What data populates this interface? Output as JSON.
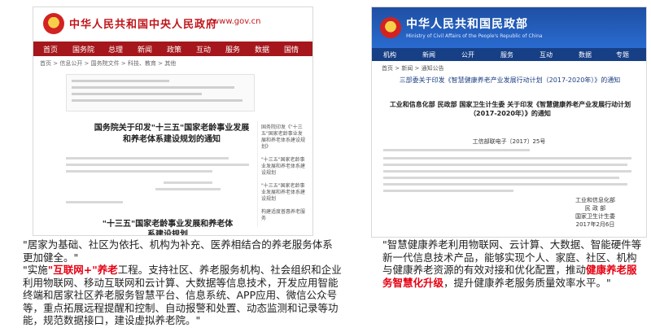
{
  "left_screenshot": {
    "site_title": "中华人民共和国中央人民政府",
    "site_domain": "www.gov.cn",
    "nav": [
      "首页",
      "国务院",
      "总理",
      "新闻",
      "政策",
      "互动",
      "服务",
      "数据",
      "国情"
    ],
    "breadcrumb": "首页 > 信息公开 > 国务院文件 > 科技、教育 > 其他",
    "doc_title": "国务院关于印发\"十三五\"国家老龄事业发展和养老体系建设规划的通知",
    "side_items": [
      "国务院印发《\"十三五\"国家老龄事业发展和养老体系建设规划》",
      "\"十三五\"国家老龄事业发展和养老体系建设规划",
      "\"十三五\"国家老龄事业发展和养老体系建设规划",
      "构建适度普惠养老服务"
    ],
    "footer_title": "\"十三五\"国家老龄事业发展和养老体系建设规划"
  },
  "right_screenshot": {
    "site_title": "中华人民共和国民政部",
    "site_subtitle": "Ministry of Civil Affairs of the People's Republic of China",
    "nav": [
      "机构",
      "新闻",
      "公开",
      "服务",
      "互动",
      "数据",
      "专题"
    ],
    "breadcrumb": "首页 > 新闻 > 通知公告",
    "doc_title": "三部委关于印发《智慧健康养老产业发展行动计划（2017-2020年）》的通知",
    "issuers": "工业和信息化部 民政部 国家卫生计生委 关于印发《智慧健康养老产业发展行动计划（2017-2020年）》的通知",
    "doc_number": "工信部联电子〔2017〕25号",
    "signature": [
      "工业和信息化部",
      "民 政 部",
      "国家卫生计生委",
      "2017年2月6日"
    ]
  },
  "caption_left": {
    "line1": "\"居家为基础、社区为依托、机构为补充、医养相结合的养老服务体系更加健全。\"",
    "line2_prefix": "\"实施",
    "line2_highlight": "\"互联网+\"养老",
    "line2_rest": "工程。支持社区、养老服务机构、社会组织和企业利用物联网、移动互联网和云计算、大数据等信息技术，开发应用智能终端和居家社区养老服务智慧平台、信息系统、APP应用、微信公众号等，重点拓展远程提醒和控制、自动报警和处置、动态监测和记录等功能，规范数据接口，建设虚拟养老院。\""
  },
  "caption_right": {
    "prefix": "\"智慧健康养老利用物联网、云计算、大数据、智能硬件等新一代信息技术产品，能够实现个人、家庭、社区、机构与健康养老资源的有效对接和优化配置，推动",
    "highlight": "健康养老服务智慧化升级",
    "suffix": "，提升健康养老服务质量效率水平。\""
  },
  "colors": {
    "gov_red": "#a5171c",
    "mca_blue": "#1e4fa3",
    "highlight_red": "#e60012"
  }
}
